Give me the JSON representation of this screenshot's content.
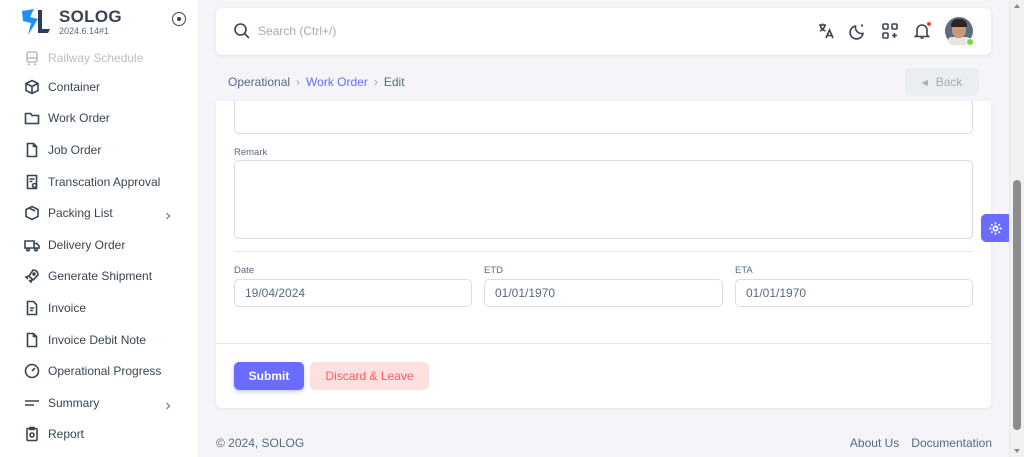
{
  "brand": {
    "name": "SOLOG",
    "version": "2024.6.14#1",
    "logo_colors": [
      "#1e90ff",
      "#2b3a67"
    ]
  },
  "sidebar": {
    "items": [
      {
        "label": "Railway Schedule",
        "icon": "train-icon",
        "faded": true
      },
      {
        "label": "Container",
        "icon": "box-icon"
      },
      {
        "label": "Work Order",
        "icon": "folder-icon"
      },
      {
        "label": "Job Order",
        "icon": "file-icon"
      },
      {
        "label": "Transcation Approval",
        "icon": "file-check-icon"
      },
      {
        "label": "Packing List",
        "icon": "package-icon",
        "has_chevron": true
      },
      {
        "label": "Delivery Order",
        "icon": "truck-icon"
      },
      {
        "label": "Generate Shipment",
        "icon": "rocket-icon"
      },
      {
        "label": "Invoice",
        "icon": "invoice-icon"
      },
      {
        "label": "Invoice Debit Note",
        "icon": "note-icon"
      },
      {
        "label": "Operational Progress",
        "icon": "gauge-icon"
      },
      {
        "label": "Summary",
        "icon": "menu-lines-icon",
        "has_chevron": true
      },
      {
        "label": "Report",
        "icon": "clipboard-icon"
      }
    ]
  },
  "navbar": {
    "search_placeholder": "Search (Ctrl+/)",
    "icons": [
      "translate-icon",
      "moon-icon",
      "apps-icon",
      "bell-icon"
    ],
    "notification_color": "#ff3e1d"
  },
  "breadcrumb": {
    "root": "Operational",
    "section": "Work Order",
    "current": "Edit",
    "back_label": "Back"
  },
  "form": {
    "remark_label": "Remark",
    "date_label": "Date",
    "date_value": "19/04/2024",
    "etd_label": "ETD",
    "etd_value": "01/01/1970",
    "eta_label": "ETA",
    "eta_value": "01/01/1970",
    "submit_label": "Submit",
    "discard_label": "Discard & Leave"
  },
  "footer": {
    "copyright": "© 2024, SOLOG",
    "links": [
      "About Us",
      "Documentation"
    ]
  },
  "colors": {
    "primary": "#696cff",
    "danger_bg": "#ffe0e0",
    "danger_text": "#ff5b5b",
    "online": "#71dd37"
  }
}
